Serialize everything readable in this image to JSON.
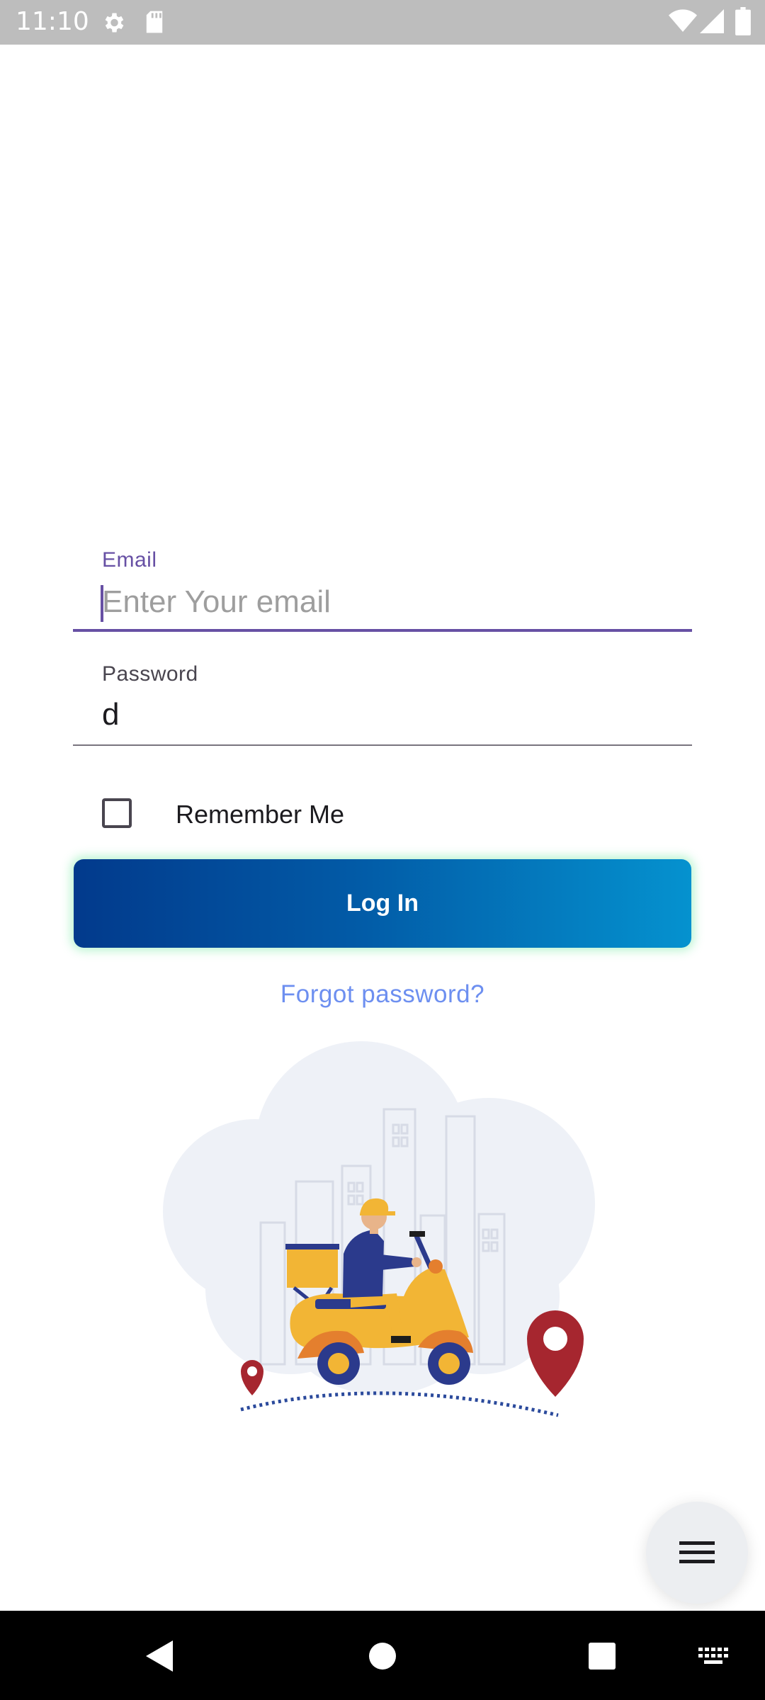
{
  "status_bar": {
    "time": "11:10",
    "icons": [
      "gear-icon",
      "sd-card-icon",
      "wifi-icon",
      "signal-icon",
      "battery-icon"
    ]
  },
  "login_form": {
    "email": {
      "label": "Email",
      "placeholder": "Enter Your email",
      "value": ""
    },
    "password": {
      "label": "Password",
      "value": "d"
    },
    "remember_me": {
      "label": "Remember Me",
      "checked": false
    },
    "login_button": "Log In",
    "forgot_password": "Forgot password?"
  },
  "colors": {
    "accent": "#6750a4",
    "button_gradient_start": "#023a8c",
    "button_gradient_end": "#0592cf",
    "link": "#6d8ff0",
    "pin": "#a6262f",
    "scooter": "#f2b535"
  },
  "illustration": "delivery-scooter-illustration",
  "fab": {
    "icon": "menu-icon"
  },
  "nav_bar": {
    "icons": [
      "back-icon",
      "home-icon",
      "recents-icon",
      "keyboard-icon"
    ]
  }
}
